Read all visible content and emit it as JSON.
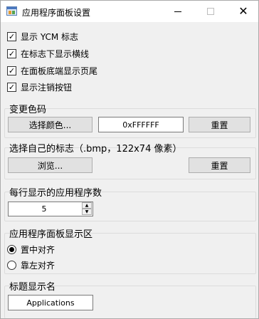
{
  "window": {
    "title": "应用程序面板设置",
    "close_symbol": "✕"
  },
  "options": [
    {
      "label": "显示 YCM 标志",
      "checked": true
    },
    {
      "label": "在标志下显示横线",
      "checked": true
    },
    {
      "label": "在面板底端显示页尾",
      "checked": true
    },
    {
      "label": "显示注销按钮",
      "checked": true
    }
  ],
  "check_mark": "✓",
  "color_group": {
    "title": "变更色码",
    "choose_label": "选择颜色...",
    "value": "0xFFFFFF",
    "reset_label": "重置"
  },
  "logo_group": {
    "title": "选择自己的标志（.bmp，122x74 像素）",
    "browse_label": "浏览...",
    "reset_label": "重置"
  },
  "count_group": {
    "title": "每行显示的应用程序数",
    "value": "5",
    "up_arrow": "▲",
    "down_arrow": "▼"
  },
  "align_group": {
    "title": "应用程序面板显示区",
    "options": [
      {
        "label": "置中对齐",
        "selected": true
      },
      {
        "label": "靠左对齐",
        "selected": false
      }
    ]
  },
  "caption_group": {
    "title": "标题显示名",
    "value": "Applications"
  }
}
